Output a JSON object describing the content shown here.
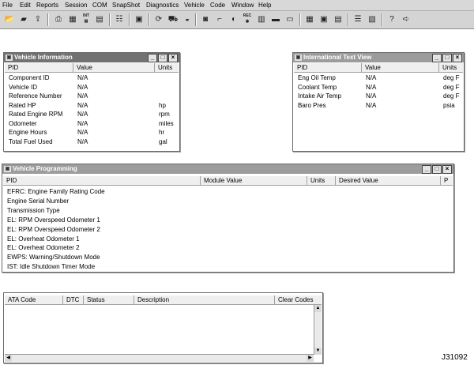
{
  "menu": [
    "File",
    "Edit",
    "Reports",
    "Session",
    "COM",
    "SnapShot",
    "Diagnostics",
    "Vehicle",
    "Code",
    "Window",
    "Help"
  ],
  "toolbar_icons": {
    "open_icon": "open-folder-icon",
    "int_label": "INT",
    "rec_label": "REC",
    "help_glyph": "?"
  },
  "vehicle_info": {
    "title": "Vehicle Information",
    "headers": [
      "PID",
      "Value",
      "Units"
    ],
    "rows": [
      {
        "pid": "Component ID",
        "value": "N/A",
        "units": ""
      },
      {
        "pid": "Vehicle ID",
        "value": "N/A",
        "units": ""
      },
      {
        "pid": "Reference Number",
        "value": "N/A",
        "units": ""
      },
      {
        "pid": "Rated HP",
        "value": "N/A",
        "units": "hp"
      },
      {
        "pid": "Rated Engine RPM",
        "value": "N/A",
        "units": "rpm"
      },
      {
        "pid": "Odometer",
        "value": "N/A",
        "units": "miles"
      },
      {
        "pid": "Engine Hours",
        "value": "N/A",
        "units": "hr"
      },
      {
        "pid": "Total Fuel Used",
        "value": "N/A",
        "units": "gal"
      }
    ]
  },
  "intl_text": {
    "title": "International Text View",
    "headers": [
      "PID",
      "Value",
      "Units"
    ],
    "rows": [
      {
        "pid": "Eng Oil Temp",
        "value": "N/A",
        "units": "deg F"
      },
      {
        "pid": "Coolant Temp",
        "value": "N/A",
        "units": "deg F"
      },
      {
        "pid": "Intake Air Temp",
        "value": "N/A",
        "units": "deg F"
      },
      {
        "pid": "Baro Pres",
        "value": "N/A",
        "units": "psia"
      }
    ]
  },
  "vehicle_prog": {
    "title": "Vehicle Programming",
    "headers": [
      "PID",
      "Module Value",
      "Units",
      "Desired Value",
      "P"
    ],
    "rows": [
      "EFRC: Engine Family Rating Code",
      "Engine Serial Number",
      "Transmission Type",
      "EL: RPM Overspeed Odometer 1",
      "EL: RPM Overspeed Odometer 2",
      "EL: Overheat Odometer 1",
      "EL: Overheat Odometer 2",
      "EWPS: Warning/Shutdown Mode",
      "IST: Idle Shutdown Timer Mode"
    ]
  },
  "dtc": {
    "headers": [
      "ATA Code",
      "DTC",
      "Status",
      "Description",
      "Clear Codes"
    ]
  },
  "window_buttons": {
    "minimize": "_",
    "restore": "□",
    "close": "×"
  },
  "figure_label": "J31092"
}
